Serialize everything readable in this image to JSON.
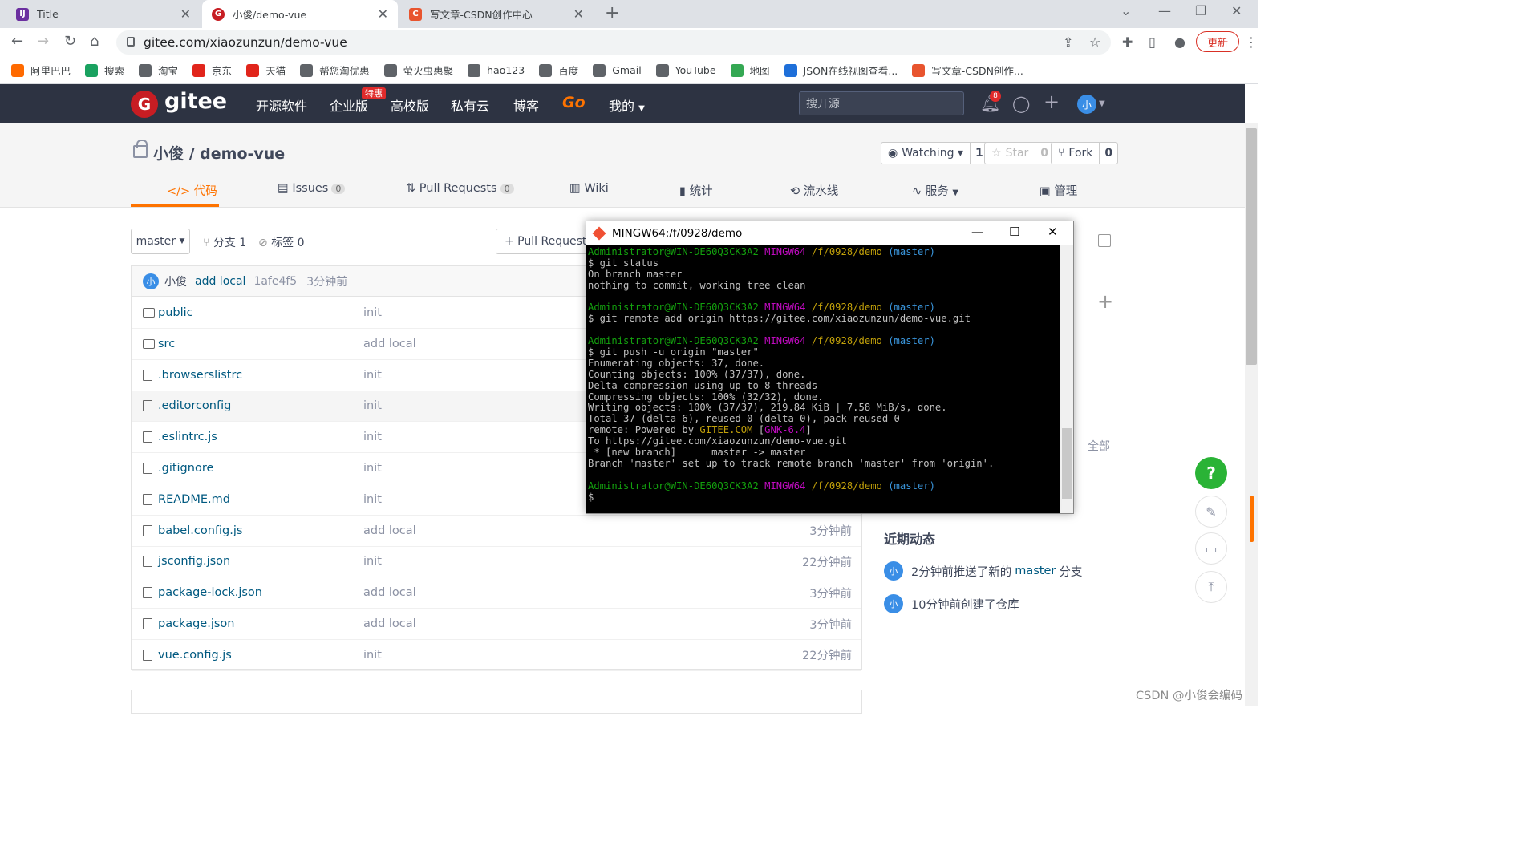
{
  "browser": {
    "tabs": [
      {
        "title": "Title",
        "icon": "idea-icon",
        "color": "#6b2fa0"
      },
      {
        "title": "小俊/demo-vue",
        "icon": "gitee-icon",
        "color": "#c71d23",
        "active": true
      },
      {
        "title": "写文章-CSDN创作中心",
        "icon": "csdn-icon",
        "color": "#e8542e"
      }
    ],
    "url": "gitee.com/xiaozunzun/demo-vue",
    "update_label": "更新",
    "bookmarks": [
      {
        "label": "阿里巴巴",
        "color": "#ff6a00"
      },
      {
        "label": "搜索",
        "color": "#1aa260"
      },
      {
        "label": "淘宝",
        "color": "#5f6368"
      },
      {
        "label": "京东",
        "color": "#e1251b"
      },
      {
        "label": "天猫",
        "color": "#e1251b"
      },
      {
        "label": "帮您淘优惠",
        "color": "#5f6368"
      },
      {
        "label": "萤火虫惠聚",
        "color": "#5f6368"
      },
      {
        "label": "hao123",
        "color": "#5f6368"
      },
      {
        "label": "百度",
        "color": "#5f6368"
      },
      {
        "label": "Gmail",
        "color": "#5f6368"
      },
      {
        "label": "YouTube",
        "color": "#5f6368"
      },
      {
        "label": "地图",
        "color": "#34a853"
      },
      {
        "label": "JSON在线视图查看...",
        "color": "#1e6fd9"
      },
      {
        "label": "写文章-CSDN创作...",
        "color": "#e8542e"
      }
    ]
  },
  "gitee": {
    "logo_text": "gitee",
    "nav": [
      "开源软件",
      "企业版",
      "高校版",
      "私有云",
      "博客",
      "Go",
      "我的"
    ],
    "badge_tehui": "特惠",
    "search_placeholder": "搜开源",
    "notif_count": "8",
    "user_avatar": "小"
  },
  "repo": {
    "title": "小俊 / demo-vue",
    "watching_label": "Watching",
    "watching_count": "1",
    "star_label": "Star",
    "star_count": "0",
    "fork_label": "Fork",
    "fork_count": "0",
    "tabs": [
      {
        "label": "代码",
        "count": ""
      },
      {
        "label": "Issues",
        "count": "0"
      },
      {
        "label": "Pull Requests",
        "count": "0"
      },
      {
        "label": "Wiki",
        "count": ""
      },
      {
        "label": "统计",
        "count": ""
      },
      {
        "label": "流水线",
        "count": ""
      },
      {
        "label": "服务",
        "count": ""
      },
      {
        "label": "管理",
        "count": ""
      }
    ],
    "branch": "master",
    "branches_label": "分支 1",
    "tags_label": "标签 0",
    "pr_button": "+ Pull Request",
    "commit": {
      "avatar": "小",
      "author": "小俊",
      "message": "add local",
      "hash": "1afe4f5",
      "time": "3分钟前"
    },
    "files": [
      {
        "name": "public",
        "type": "folder",
        "msg": "init",
        "time": ""
      },
      {
        "name": "src",
        "type": "folder",
        "msg": "add local",
        "time": ""
      },
      {
        "name": ".browserslistrc",
        "type": "file",
        "msg": "init",
        "time": ""
      },
      {
        "name": ".editorconfig",
        "type": "file",
        "msg": "init",
        "time": ""
      },
      {
        "name": ".eslintrc.js",
        "type": "file",
        "msg": "init",
        "time": ""
      },
      {
        "name": ".gitignore",
        "type": "file",
        "msg": "init",
        "time": ""
      },
      {
        "name": "README.md",
        "type": "file",
        "msg": "init",
        "time": ""
      },
      {
        "name": "babel.config.js",
        "type": "file",
        "msg": "add local",
        "time": "3分钟前"
      },
      {
        "name": "jsconfig.json",
        "type": "file",
        "msg": "init",
        "time": "22分钟前"
      },
      {
        "name": "package-lock.json",
        "type": "file",
        "msg": "add local",
        "time": "3分钟前"
      },
      {
        "name": "package.json",
        "type": "file",
        "msg": "add local",
        "time": "3分钟前"
      },
      {
        "name": "vue.config.js",
        "type": "file",
        "msg": "init",
        "time": "22分钟前"
      }
    ]
  },
  "sidebar": {
    "all_label": "全部",
    "recent_title": "近期动态",
    "activities": [
      {
        "avatar": "小",
        "pre": "2分钟前推送了新的",
        "link": "master",
        "post": "分支"
      },
      {
        "avatar": "小",
        "pre": "10分钟前创建了仓库",
        "link": "",
        "post": ""
      }
    ]
  },
  "help_label": "?",
  "watermark": "CSDN @小俊会编码",
  "terminal": {
    "title": "MINGW64:/f/0928/demo",
    "lines": [
      {
        "segs": [
          [
            "Administrator@WIN-DE60Q3CK3A2 ",
            "c-green"
          ],
          [
            "MINGW64 ",
            "c-mag"
          ],
          [
            "/f/0928/demo ",
            "c-yel"
          ],
          [
            "(master)",
            "c-cyan"
          ]
        ]
      },
      {
        "segs": [
          [
            "$ git status",
            ""
          ]
        ]
      },
      {
        "segs": [
          [
            "On branch master",
            ""
          ]
        ]
      },
      {
        "segs": [
          [
            "nothing to commit, working tree clean",
            ""
          ]
        ]
      },
      {
        "segs": [
          [
            "",
            ""
          ]
        ]
      },
      {
        "segs": [
          [
            "Administrator@WIN-DE60Q3CK3A2 ",
            "c-green"
          ],
          [
            "MINGW64 ",
            "c-mag"
          ],
          [
            "/f/0928/demo ",
            "c-yel"
          ],
          [
            "(master)",
            "c-cyan"
          ]
        ]
      },
      {
        "segs": [
          [
            "$ git remote add origin https://gitee.com/xiaozunzun/demo-vue.git",
            ""
          ]
        ]
      },
      {
        "segs": [
          [
            "",
            ""
          ]
        ]
      },
      {
        "segs": [
          [
            "Administrator@WIN-DE60Q3CK3A2 ",
            "c-green"
          ],
          [
            "MINGW64 ",
            "c-mag"
          ],
          [
            "/f/0928/demo ",
            "c-yel"
          ],
          [
            "(master)",
            "c-cyan"
          ]
        ]
      },
      {
        "segs": [
          [
            "$ git push -u origin \"master\"",
            ""
          ]
        ]
      },
      {
        "segs": [
          [
            "Enumerating objects: 37, done.",
            ""
          ]
        ]
      },
      {
        "segs": [
          [
            "Counting objects: 100% (37/37), done.",
            ""
          ]
        ]
      },
      {
        "segs": [
          [
            "Delta compression using up to 8 threads",
            ""
          ]
        ]
      },
      {
        "segs": [
          [
            "Compressing objects: 100% (32/32), done.",
            ""
          ]
        ]
      },
      {
        "segs": [
          [
            "Writing objects: 100% (37/37), 219.84 KiB | 7.58 MiB/s, done.",
            ""
          ]
        ]
      },
      {
        "segs": [
          [
            "Total 37 (delta 6), reused 0 (delta 0), pack-reused 0",
            ""
          ]
        ]
      },
      {
        "segs": [
          [
            "remote: Powered by ",
            ""
          ],
          [
            "GITEE.COM ",
            "c-yel"
          ],
          [
            "[",
            ""
          ],
          [
            "GNK-6.4",
            "c-mag"
          ],
          [
            "]",
            ""
          ]
        ]
      },
      {
        "segs": [
          [
            "To https://gitee.com/xiaozunzun/demo-vue.git",
            ""
          ]
        ]
      },
      {
        "segs": [
          [
            " * [new branch]      master -> master",
            ""
          ]
        ]
      },
      {
        "segs": [
          [
            "Branch 'master' set up to track remote branch 'master' from 'origin'.",
            ""
          ]
        ]
      },
      {
        "segs": [
          [
            "",
            ""
          ]
        ]
      },
      {
        "segs": [
          [
            "Administrator@WIN-DE60Q3CK3A2 ",
            "c-green"
          ],
          [
            "MINGW64 ",
            "c-mag"
          ],
          [
            "/f/0928/demo ",
            "c-yel"
          ],
          [
            "(master)",
            "c-cyan"
          ]
        ]
      },
      {
        "segs": [
          [
            "$",
            ""
          ]
        ]
      }
    ]
  }
}
